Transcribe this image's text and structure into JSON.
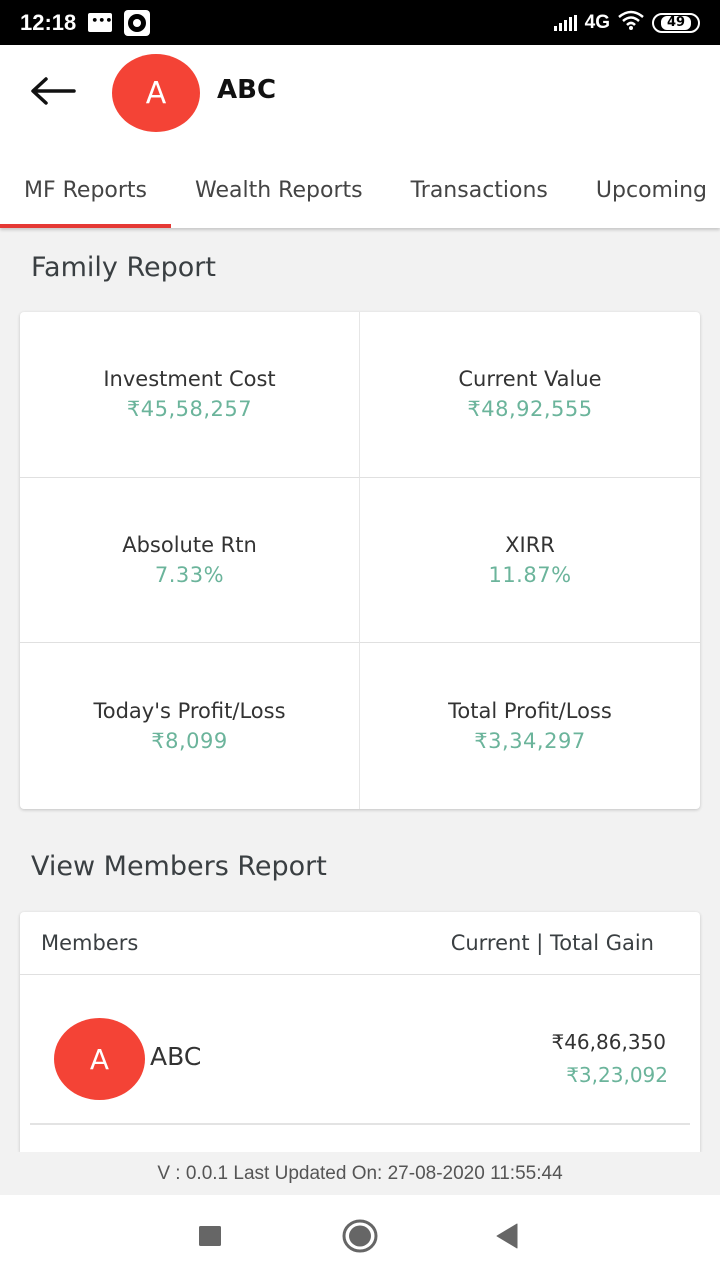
{
  "status_bar": {
    "time": "12:18",
    "network": "4G",
    "battery": "49",
    "icons": [
      "message-icon",
      "screen-record-icon",
      "signal-icon",
      "wifi-icon",
      "battery-icon"
    ]
  },
  "header": {
    "back_icon": "arrow-left-icon",
    "avatar_initial": "A",
    "name": "ABC",
    "brand_color": "#f44336"
  },
  "tabs": [
    {
      "label": "MF Reports",
      "active": true
    },
    {
      "label": "Wealth Reports",
      "active": false
    },
    {
      "label": "Transactions",
      "active": false
    },
    {
      "label": "Upcoming",
      "active": false
    }
  ],
  "family_report": {
    "title": "Family Report",
    "metrics": [
      {
        "label": "Investment Cost",
        "value": "₹45,58,257"
      },
      {
        "label": "Current Value",
        "value": "₹48,92,555"
      },
      {
        "label": "Absolute Rtn",
        "value": "7.33%"
      },
      {
        "label": "XIRR",
        "value": "11.87%"
      },
      {
        "label": "Today's Profit/Loss",
        "value": "₹8,099"
      },
      {
        "label": "Total Profit/Loss",
        "value": "₹3,34,297"
      }
    ],
    "value_color": "#6bb49b"
  },
  "members_report": {
    "title": "View Members Report",
    "col_members": "Members",
    "col_values": "Current | Total Gain",
    "members": [
      {
        "initial": "A",
        "name": "ABC",
        "current": "₹46,86,350",
        "gain": "₹3,23,092"
      }
    ]
  },
  "footer": {
    "text": "V : 0.0.1 Last Updated On: 27-08-2020 11:55:44"
  },
  "nav": {
    "recents": "recents-square-icon",
    "home": "home-circle-icon",
    "back": "back-triangle-icon"
  }
}
